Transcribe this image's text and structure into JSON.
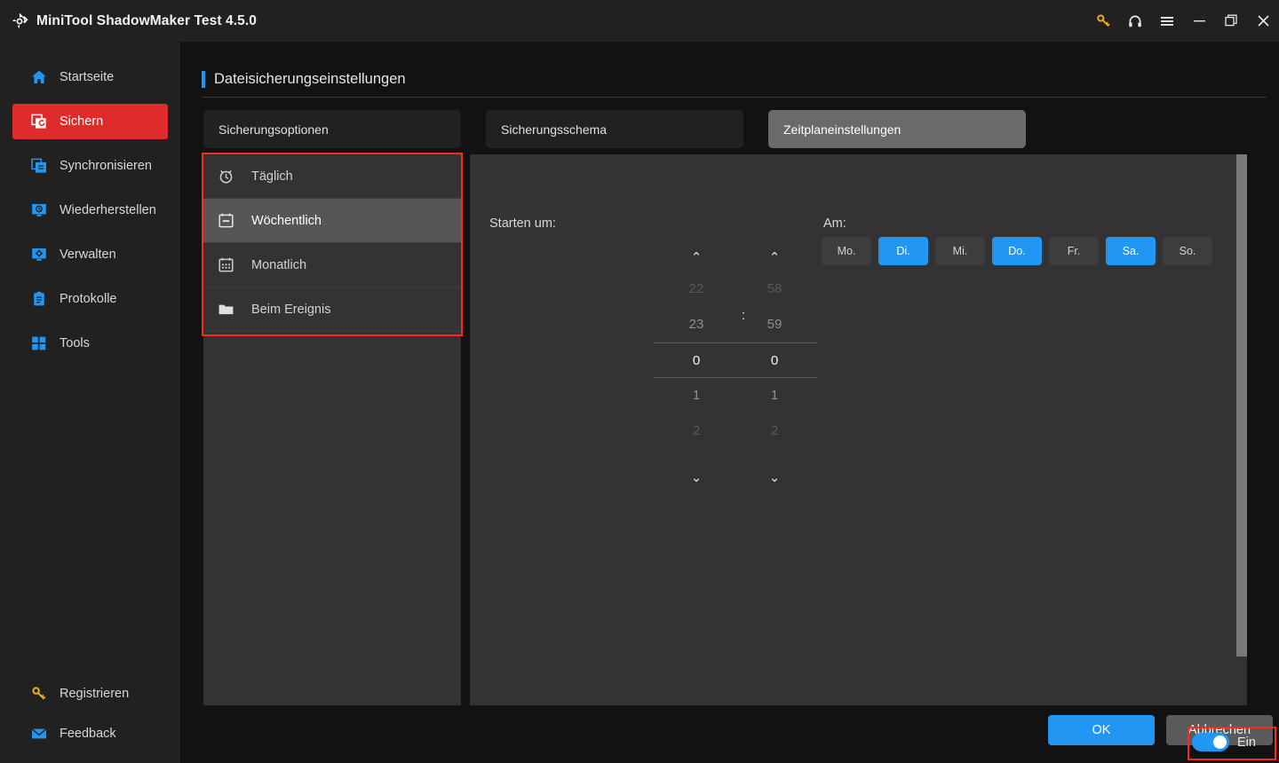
{
  "window": {
    "title": "MiniTool ShadowMaker Test 4.5.0",
    "logo_icon": "shadowmaker-logo-icon",
    "controls": [
      {
        "name": "key-icon",
        "glyph": "⚷"
      },
      {
        "name": "headset-icon",
        "glyph": "⌂"
      },
      {
        "name": "menu-icon",
        "glyph": "☰"
      },
      {
        "name": "minimize-icon",
        "glyph": "─"
      },
      {
        "name": "restore-icon",
        "glyph": "❐"
      },
      {
        "name": "close-icon",
        "glyph": "✕"
      }
    ]
  },
  "sidebar": {
    "items": [
      {
        "label": "Startseite",
        "icon": "home-icon",
        "active": false
      },
      {
        "label": "Sichern",
        "icon": "backup-icon",
        "active": true
      },
      {
        "label": "Synchronisieren",
        "icon": "sync-icon",
        "active": false
      },
      {
        "label": "Wiederherstellen",
        "icon": "restore-icon",
        "active": false
      },
      {
        "label": "Verwalten",
        "icon": "manage-icon",
        "active": false
      },
      {
        "label": "Protokolle",
        "icon": "logs-icon",
        "active": false
      },
      {
        "label": "Tools",
        "icon": "tools-icon",
        "active": false
      }
    ],
    "bottom_items": [
      {
        "label": "Registrieren",
        "icon": "key-icon",
        "active": false
      },
      {
        "label": "Feedback",
        "icon": "mail-icon",
        "active": false
      }
    ]
  },
  "page": {
    "title": "Dateisicherungseinstellungen",
    "accent_color": "#2196f3"
  },
  "tabs": [
    {
      "label": "Sicherungsoptionen",
      "active": false
    },
    {
      "label": "Sicherungsschema",
      "active": false
    },
    {
      "label": "Zeitplaneinstellungen",
      "active": true
    }
  ],
  "schedule_list": {
    "highlight_color": "#ff2a16",
    "items": [
      {
        "label": "Täglich",
        "icon": "alarm-clock-icon",
        "selected": false
      },
      {
        "label": "Wöchentlich",
        "icon": "calendar-week-icon",
        "selected": true
      },
      {
        "label": "Monatlich",
        "icon": "calendar-month-icon",
        "selected": false
      },
      {
        "label": "Beim Ereignis",
        "icon": "folder-icon",
        "selected": false
      }
    ]
  },
  "detail": {
    "start_label": "Starten um:",
    "on_label": "Am:",
    "time": {
      "separator": ":",
      "up_arrow": "⌃",
      "down_arrow": "⌄",
      "hour": {
        "ticks": [
          "22",
          "23",
          "0",
          "1",
          "2"
        ],
        "selected_index": 2,
        "value": "0"
      },
      "minute": {
        "ticks": [
          "58",
          "59",
          "0",
          "1",
          "2"
        ],
        "selected_index": 2,
        "value": "0"
      }
    },
    "days": [
      {
        "label": "Mo.",
        "on": false
      },
      {
        "label": "Di.",
        "on": true
      },
      {
        "label": "Mi.",
        "on": false
      },
      {
        "label": "Do.",
        "on": true
      },
      {
        "label": "Fr.",
        "on": false
      },
      {
        "label": "Sa.",
        "on": true
      },
      {
        "label": "So.",
        "on": false
      }
    ]
  },
  "footer": {
    "toggle": {
      "label": "Ein",
      "on": true,
      "color": "#2196f3",
      "highlight_color": "#ff2a16"
    },
    "ok_label": "OK",
    "cancel_label": "Abbrechen"
  }
}
